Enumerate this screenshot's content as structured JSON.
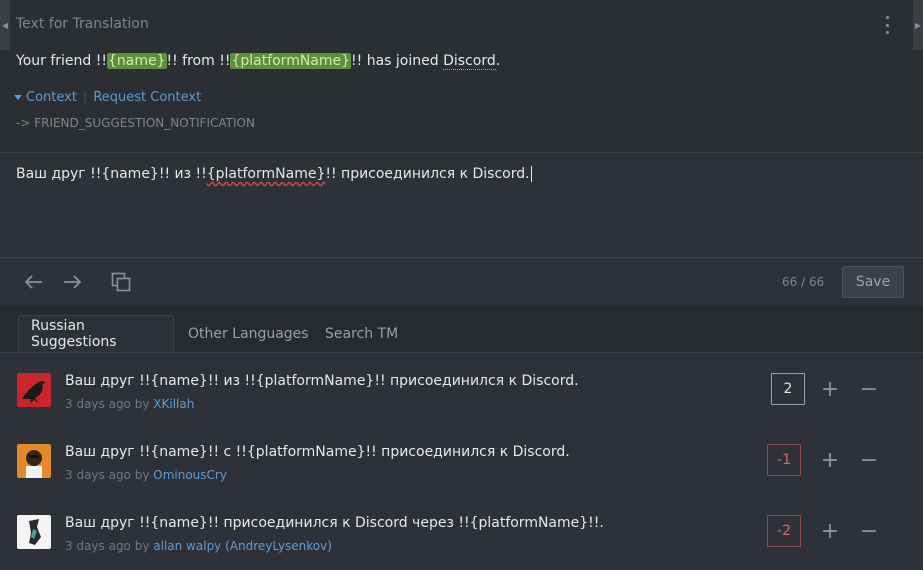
{
  "source_panel": {
    "title": "Text for Translation",
    "text_parts": [
      "Your friend !!",
      "{name}",
      "!! from !!",
      "{platformName}",
      "!! has joined ",
      "Discord",
      "."
    ],
    "context_label": "Context",
    "request_context_label": "Request Context",
    "string_key": "-> FRIEND_SUGGESTION_NOTIFICATION"
  },
  "editor": {
    "parts": [
      "Ваш друг !!{name}!! из !!",
      "{platformName}",
      "!! присоединился к Discord."
    ]
  },
  "toolbar": {
    "icons": [
      "arrow-left-icon",
      "arrow-right-icon",
      "copy-source-icon"
    ],
    "counter": "66 / 66",
    "save_label": "Save"
  },
  "tabs": [
    "Russian Suggestions",
    "Other Languages",
    "Search TM"
  ],
  "suggestions": [
    {
      "text": "Ваш друг !!{name}!! из !!{platformName}!! присоединился к Discord.",
      "time": "3 days ago by",
      "user": "XKillah",
      "votes": "2"
    },
    {
      "text": "Ваш друг !!{name}!! с !!{platformName}!! присоединился к Discord.",
      "time": "3 days ago by",
      "user": "OminousCry",
      "votes": "-1"
    },
    {
      "text": "Ваш друг !!{name}!! присоединился к Discord через !!{platformName}!!.",
      "time": "3 days ago by",
      "user": "allan walpy (AndreyLysenkov)",
      "votes": "-2"
    }
  ],
  "colors": {
    "accent": "#5b9bd5",
    "placeholder_bg": "#5c8f3e",
    "negative": "#d06a6a"
  }
}
